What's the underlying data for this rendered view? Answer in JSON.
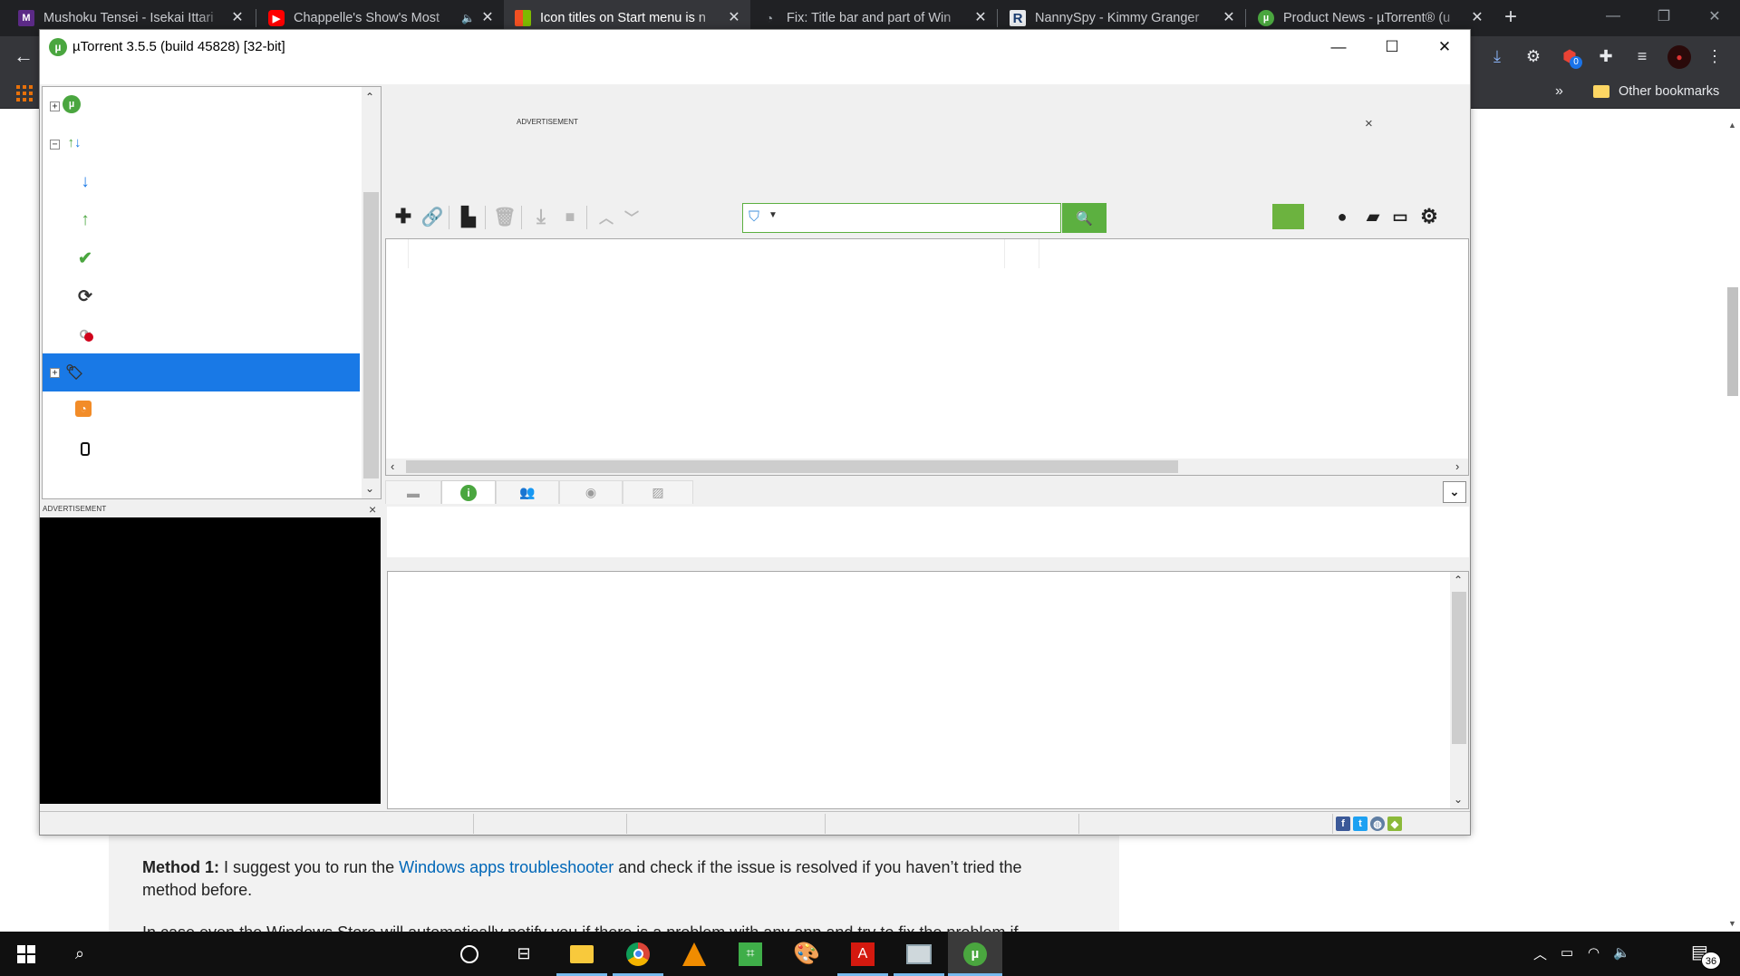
{
  "browser": {
    "tabs": [
      {
        "title": "Mushoku Tensei - Isekai Ittari",
        "icon": "manga-site-icon"
      },
      {
        "title": "Chappelle's Show's Most",
        "icon": "youtube-icon",
        "muted_audio": true
      },
      {
        "title": "Icon titles on Start menu is n",
        "icon": "microsoft-icon",
        "active": true
      },
      {
        "title": "Fix: Title bar and part of Win",
        "icon": "loading-icon"
      },
      {
        "title": "NannySpy - Kimmy Granger",
        "icon": "r-letter-icon"
      },
      {
        "title": "Product News - µTorrent® (u",
        "icon": "utorrent-icon"
      }
    ],
    "extensions": [
      "download-icon",
      "extension-icon",
      "adblock-icon",
      "puzzle-icon",
      "playlist-icon",
      "profile-avatar"
    ],
    "extension_badge": "0",
    "bookmarks": {
      "overflow": "»",
      "other": "Other bookmarks"
    }
  },
  "article": {
    "method_label": "Method 1:",
    "text_before": " I suggest you to run the ",
    "link": "Windows apps troubleshooter",
    "text_after": " and check if the issue is resolved if you haven’t tried the method before.",
    "next_line": "In case even the Windows Store will automatically notify you if there is a problem with any app and try to fix the problem if"
  },
  "utorrent": {
    "title": "µTorrent 3.5.5  (build 45828) [32-bit]",
    "controls": {
      "minimize": "—",
      "maximize": "☐",
      "close": "✕"
    },
    "sidebar": [
      {
        "name": "torrents",
        "icon": "utorrent-logo-icon",
        "expander": "+"
      },
      {
        "name": "all-transfers",
        "icon": "transfer-arrows-icon",
        "expander": "−"
      },
      {
        "name": "downloading",
        "icon": "download-arrow-icon"
      },
      {
        "name": "seeding",
        "icon": "upload-arrow-icon"
      },
      {
        "name": "completed",
        "icon": "checkmark-icon"
      },
      {
        "name": "active",
        "icon": "refresh-icon"
      },
      {
        "name": "inactive",
        "icon": "inactive-icon"
      },
      {
        "name": "labels",
        "icon": "label-tag-icon",
        "expander": "+",
        "selected": true
      },
      {
        "name": "feeds",
        "icon": "rss-feed-icon"
      },
      {
        "name": "devices",
        "icon": "device-icon"
      }
    ],
    "ad_label": "ADVERTISEMENT",
    "ad_close": "×",
    "toolbar": {
      "icons": [
        "add-torrent-icon",
        "add-link-icon",
        "create-torrent-icon",
        "remove-icon",
        "start-icon",
        "stop-icon",
        "move-up-icon",
        "move-down-icon"
      ],
      "right_icons": [
        "bulb-icon",
        "chat-icon",
        "remote-icon",
        "settings-icon"
      ],
      "search_placeholder": ""
    },
    "detail_tabs": [
      "files-tab",
      "info-tab",
      "peers-tab",
      "trackers-tab",
      "speed-tab"
    ],
    "active_detail_tab": "info-tab"
  },
  "taskbar": {
    "apps": [
      "cortana-icon",
      "task-view-icon",
      "file-explorer-icon",
      "chrome-icon",
      "vlc-icon",
      "greenshot-icon",
      "paint-icon",
      "acrobat-icon",
      "remote-desktop-icon",
      "utorrent-taskbar-icon"
    ],
    "notification_count": "36"
  },
  "colors": {
    "selection": "#1979e6",
    "utorrent_green": "#5cb040",
    "chrome_dark": "#202124"
  }
}
